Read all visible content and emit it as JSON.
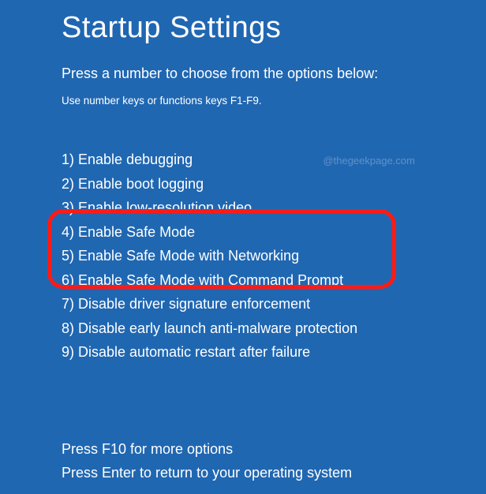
{
  "title": "Startup Settings",
  "subtitle": "Press a number to choose from the options below:",
  "hint": "Use number keys or functions keys F1-F9.",
  "watermark": "@thegeekpage.com",
  "options": [
    {
      "num": "1",
      "label": "Enable debugging"
    },
    {
      "num": "2",
      "label": "Enable boot logging"
    },
    {
      "num": "3",
      "label": "Enable low-resolution video"
    },
    {
      "num": "4",
      "label": "Enable Safe Mode"
    },
    {
      "num": "5",
      "label": "Enable Safe Mode with Networking"
    },
    {
      "num": "6",
      "label": "Enable Safe Mode with Command Prompt"
    },
    {
      "num": "7",
      "label": "Disable driver signature enforcement"
    },
    {
      "num": "8",
      "label": "Disable early launch anti-malware protection"
    },
    {
      "num": "9",
      "label": "Disable automatic restart after failure"
    }
  ],
  "footer": {
    "more": "Press F10 for more options",
    "return": "Press Enter to return to your operating system"
  },
  "colors": {
    "background": "#2067b2",
    "text": "#ffffff",
    "highlight": "#ff1a16"
  }
}
